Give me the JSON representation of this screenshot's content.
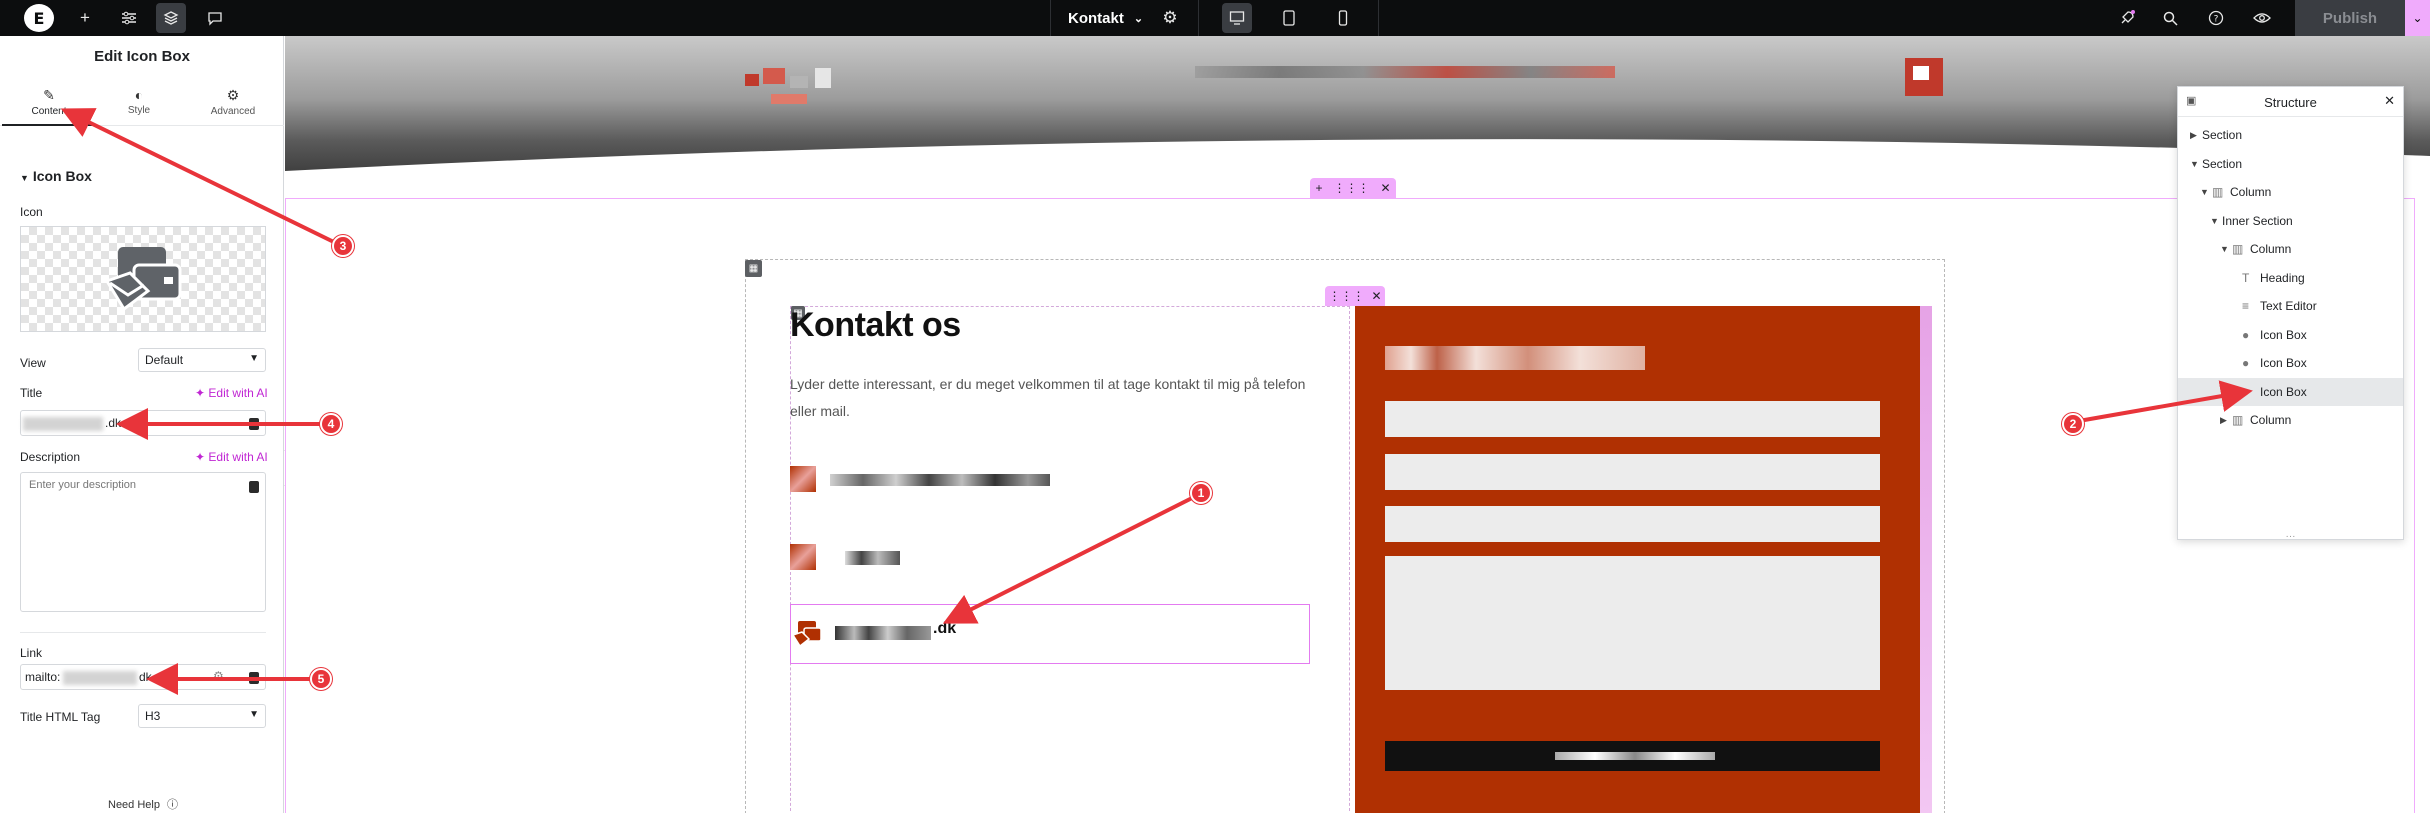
{
  "topbar": {
    "page_name": "Kontakt",
    "publish_label": "Publish"
  },
  "panel": {
    "title": "Edit Icon Box",
    "tabs": [
      {
        "label": "Content",
        "icon": "pencil-icon"
      },
      {
        "label": "Style",
        "icon": "half-circle-icon"
      },
      {
        "label": "Advanced",
        "icon": "gear-icon"
      }
    ],
    "section_title": "Icon Box",
    "icon_label": "Icon",
    "view_label": "View",
    "view_value": "Default",
    "title_label": "Title",
    "title_value_suffix": ".dk",
    "edit_ai_label": "Edit with AI",
    "description_label": "Description",
    "description_placeholder": "Enter your description",
    "link_label": "Link",
    "link_value_prefix": "mailto:",
    "link_value_suffix": "dk",
    "html_tag_label": "Title HTML Tag",
    "html_tag_value": "H3",
    "need_help": "Need Help"
  },
  "canvas": {
    "heading": "Kontakt os",
    "body_text": "Lyder dette interessant, er du meget velkommen til at tage kontakt til mig på telefon eller mail.",
    "email_suffix": ".dk"
  },
  "structure": {
    "title": "Structure",
    "items": [
      {
        "label": "Section",
        "depth": 0,
        "caret": "right",
        "icon": "none"
      },
      {
        "label": "Section",
        "depth": 0,
        "caret": "down",
        "icon": "none"
      },
      {
        "label": "Column",
        "depth": 1,
        "caret": "down",
        "icon": "column-icon"
      },
      {
        "label": "Inner Section",
        "depth": 2,
        "caret": "down",
        "icon": "none"
      },
      {
        "label": "Column",
        "depth": 3,
        "caret": "down",
        "icon": "column-icon"
      },
      {
        "label": "Heading",
        "depth": 4,
        "caret": "none",
        "icon": "heading-icon"
      },
      {
        "label": "Text Editor",
        "depth": 4,
        "caret": "none",
        "icon": "text-editor-icon"
      },
      {
        "label": "Icon Box",
        "depth": 4,
        "caret": "none",
        "icon": "person-icon"
      },
      {
        "label": "Icon Box",
        "depth": 4,
        "caret": "none",
        "icon": "person-icon"
      },
      {
        "label": "Icon Box",
        "depth": 4,
        "caret": "none",
        "icon": "person-icon",
        "active": true
      },
      {
        "label": "Column",
        "depth": 3,
        "caret": "right",
        "icon": "column-icon"
      }
    ]
  },
  "annotations": [
    "1",
    "2",
    "3",
    "4",
    "5"
  ],
  "colors": {
    "accent": "#f0abfc",
    "brand_red": "#b03002",
    "annotation_red": "#e8343a",
    "ai_link": "#c026d3"
  }
}
